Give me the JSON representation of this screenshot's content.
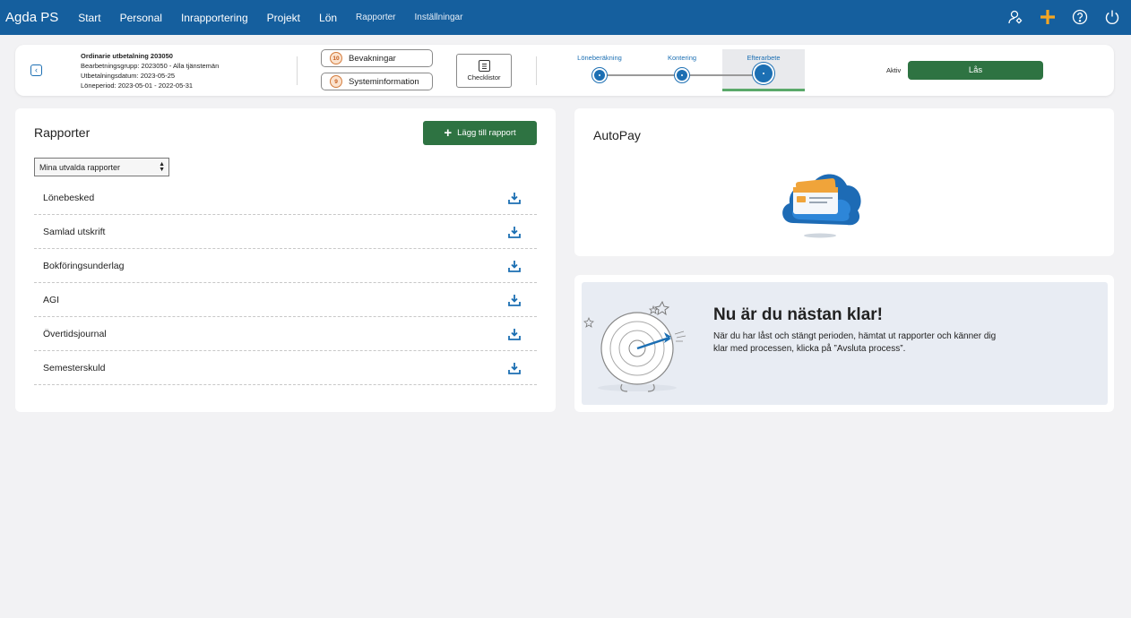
{
  "nav": {
    "brand": "Agda PS",
    "items": [
      {
        "label": "Start"
      },
      {
        "label": "Personal"
      },
      {
        "label": "Inrapportering"
      },
      {
        "label": "Projekt"
      },
      {
        "label": "Lön"
      },
      {
        "label": "Rapporter"
      },
      {
        "label": "Inställningar"
      }
    ],
    "icons": [
      "user-settings-icon",
      "plus-icon",
      "help-icon",
      "power-icon"
    ]
  },
  "process": {
    "title": "Ordinarie utbetalning 203050",
    "group": "Bearbetningsgrupp: 2023050 - Alla tjänstemän",
    "pay_date": "Utbetalningsdatum: 2023-05-25",
    "period": "Löneperiod: 2023-05-01 - 2022-05-31",
    "watch": {
      "count": "10",
      "label": "Bevakningar"
    },
    "sysinfo": {
      "count": "9",
      "label": "Systeminformation"
    },
    "checklists_label": "Checklistor",
    "steps": [
      {
        "label": "Löneberäkning"
      },
      {
        "label": "Kontering"
      },
      {
        "label": "Efterarbete"
      }
    ],
    "status_label": "Aktiv",
    "lock_label": "Lås"
  },
  "reports": {
    "title": "Rapporter",
    "add_label": "Lägg till rapport",
    "filter_value": "Mina utvalda rapporter",
    "items": [
      {
        "label": "Lönebesked"
      },
      {
        "label": "Samlad utskrift"
      },
      {
        "label": "Bokföringsunderlag"
      },
      {
        "label": "AGI"
      },
      {
        "label": "Övertidsjournal"
      },
      {
        "label": "Semesterskuld"
      }
    ]
  },
  "autopay": {
    "title": "AutoPay"
  },
  "promo": {
    "title": "Nu är du nästan klar!",
    "text": "När du har låst och stängt perioden, hämtat ut rapporter och känner dig klar med processen, klicka på ”Avsluta process”."
  },
  "colors": {
    "nav_bg": "#155f9e",
    "primary_green": "#2e7342",
    "accent_blue": "#1c6fb3",
    "plus_orange": "#f5a623"
  }
}
